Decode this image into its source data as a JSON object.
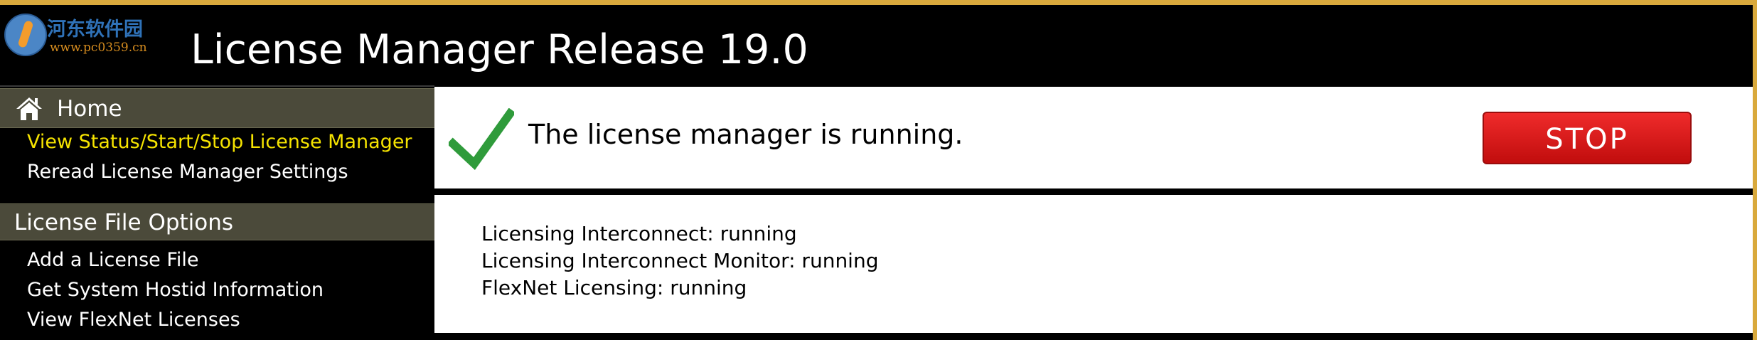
{
  "header": {
    "title": "License Manager Release 19.0",
    "watermark": {
      "text": "河东软件园",
      "url": "www.pc0359.cn"
    }
  },
  "sidebar": {
    "home": {
      "label": "Home",
      "icon": "home-icon",
      "items": [
        {
          "label": "View Status/Start/Stop License Manager",
          "active": true
        },
        {
          "label": "Reread License Manager Settings",
          "active": false
        }
      ]
    },
    "license_file_options": {
      "label": "License File Options",
      "items": [
        {
          "label": "Add a License File"
        },
        {
          "label": "Get System Hostid Information"
        },
        {
          "label": "View FlexNet Licenses"
        }
      ]
    }
  },
  "main": {
    "status_text": "The license manager is running.",
    "status_icon": "checkmark-icon",
    "stop_button": "STOP",
    "services": [
      "Licensing Interconnect: running",
      "Licensing Interconnect Monitor: running",
      "FlexNet Licensing: running"
    ]
  },
  "colors": {
    "accent_border": "#d9a93c",
    "section_bg": "#4b4a3a",
    "active_link": "#f5e300",
    "stop_button": "#d41414",
    "check": "#2f9b3b"
  }
}
